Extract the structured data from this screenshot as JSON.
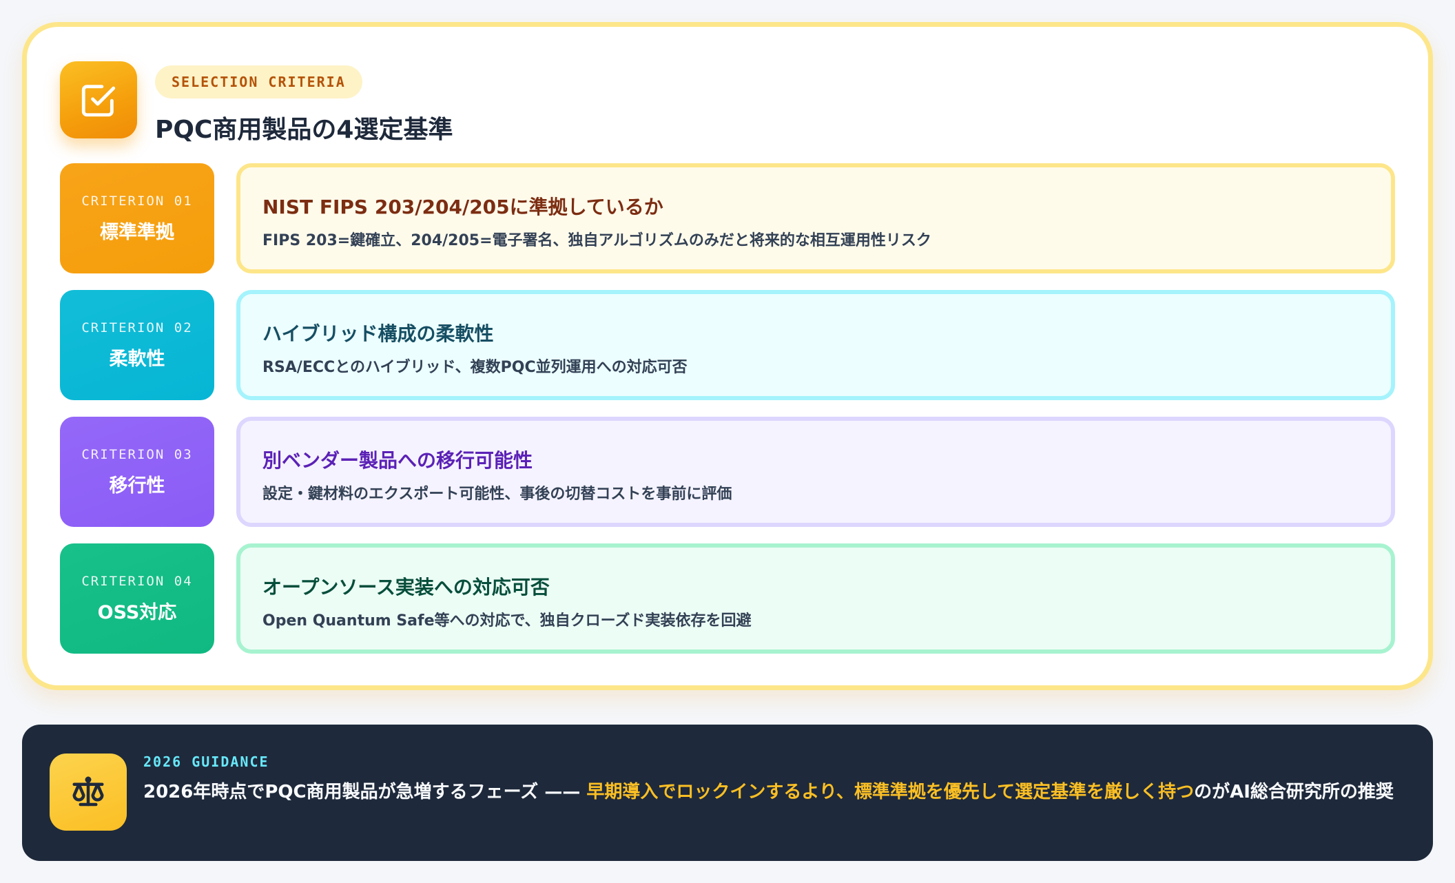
{
  "header": {
    "eyebrow": "SELECTION CRITERIA",
    "title": "PQC商用製品の4選定基準",
    "icon": "checkbox-icon"
  },
  "criteria": [
    {
      "code": "CRITERION 01",
      "name": "標準準拠",
      "title": "NIST FIPS 203/204/205に準拠しているか",
      "desc": "FIPS 203=鍵確立、204/205=電子署名、独自アルゴリズムのみだと将来的な相互運用性リスク",
      "accent": "#f59e0b"
    },
    {
      "code": "CRITERION 02",
      "name": "柔軟性",
      "title": "ハイブリッド構成の柔軟性",
      "desc": "RSA/ECCとのハイブリッド、複数PQC並列運用への対応可否",
      "accent": "#06b6d4"
    },
    {
      "code": "CRITERION 03",
      "name": "移行性",
      "title": "別ベンダー製品への移行可能性",
      "desc": "設定・鍵材料のエクスポート可能性、事後の切替コストを事前に評価",
      "accent": "#8b5cf6"
    },
    {
      "code": "CRITERION 04",
      "name": "OSS対応",
      "title": "オープンソース実装への対応可否",
      "desc": "Open Quantum Safe等への対応で、独自クローズド実装依存を回避",
      "accent": "#10b981"
    }
  ],
  "guidance": {
    "eyebrow": "2026 GUIDANCE",
    "text_before": "2026年時点でPQC商用製品が急増するフェーズ —— ",
    "text_highlight": "早期導入でロックインするより、標準準拠を優先して選定基準を厳しく持つ",
    "text_after": "のがAI総合研究所の推奨",
    "highlight_color": "#fbbf24",
    "icon": "balance-scale-icon"
  }
}
